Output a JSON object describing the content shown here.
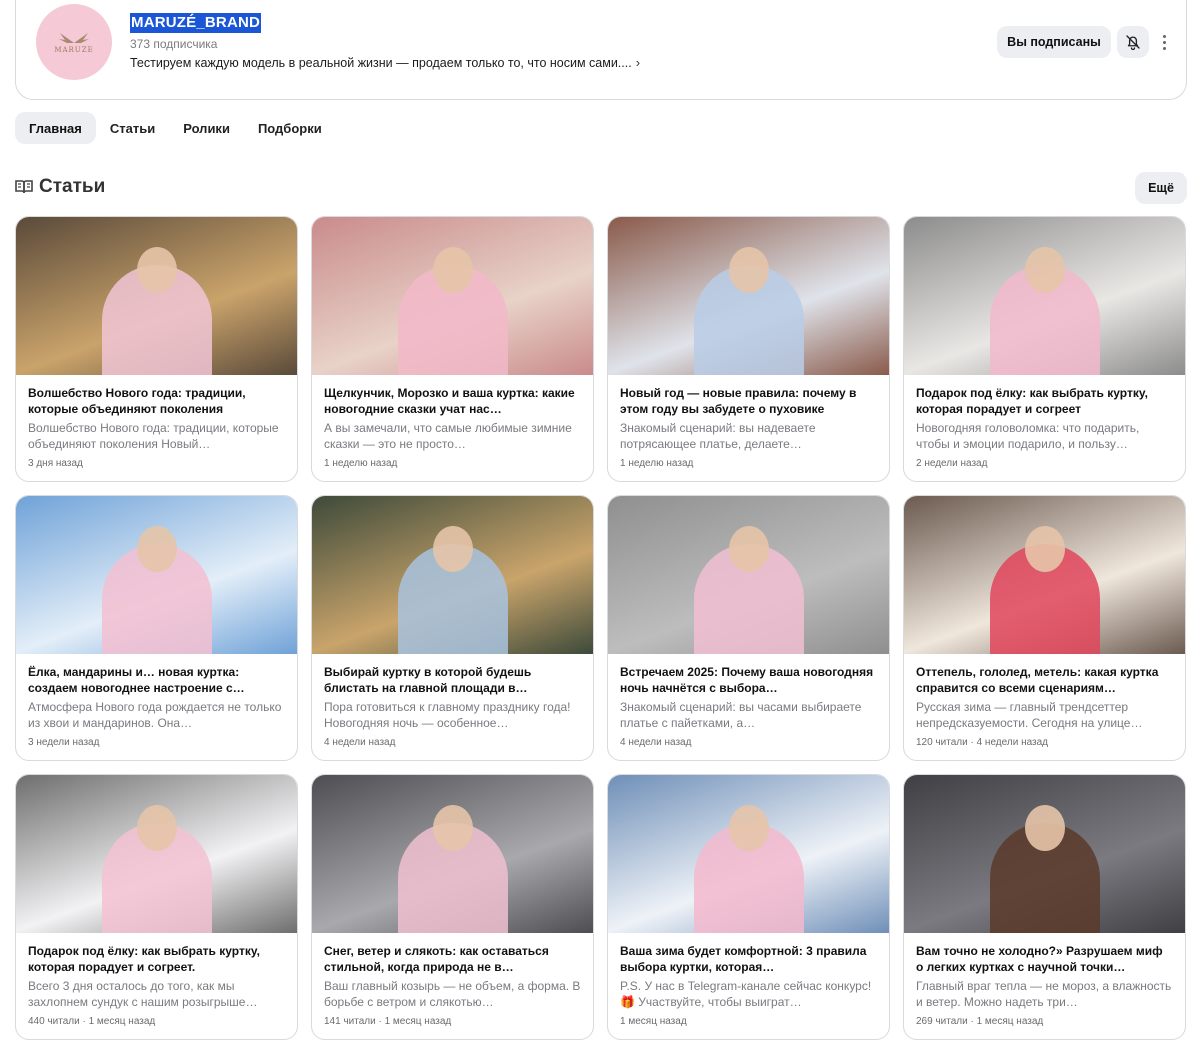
{
  "channel": {
    "logo_text": "MARUZE",
    "name": "MARUZÉ_BRAND",
    "subscribers": "373 подписчика",
    "description": "Тестируем каждую модель в реальной жизни — продаем только то, что носим сами....",
    "subscribed_label": "Вы подписаны"
  },
  "tabs": [
    {
      "label": "Главная",
      "active": true
    },
    {
      "label": "Статьи",
      "active": false
    },
    {
      "label": "Ролики",
      "active": false
    },
    {
      "label": "Подборки",
      "active": false
    }
  ],
  "section": {
    "title": "Статьи",
    "more_label": "Ещё"
  },
  "colors": {
    "accent_selection": "#1a56d6",
    "button_bg": "#eceef1",
    "avatar_bg": "#f6c9d6"
  },
  "articles": [
    {
      "title": "Волшебство Нового года: традиции, которые объединяют поколения",
      "snippet": "Волшебство Нового года: традиции, которые объединяют поколения Новый…",
      "meta": "3 дня назад",
      "palette": [
        "#5a4a3a",
        "#caa36b",
        "#f1c6d6"
      ]
    },
    {
      "title": "Щелкунчик, Морозко и ваша куртка: какие новогодние сказки учат нас…",
      "snippet": "А вы замечали, что самые любимые зимние сказки — это не просто…",
      "meta": "1 неделю назад",
      "palette": [
        "#c98b8b",
        "#e8d2c8",
        "#f2b9c9"
      ]
    },
    {
      "title": "Новый год — новые правила: почему в этом году вы забудете о пуховике",
      "snippet": "Знакомый сценарий: вы надеваете потрясающее платье, делаете…",
      "meta": "1 неделю назад",
      "palette": [
        "#8a5a4a",
        "#dfe3ea",
        "#b9cde6"
      ]
    },
    {
      "title": "Подарок под ёлку: как выбрать куртку, которая порадует и согреет",
      "snippet": "Новогодняя головоломка: что подарить, чтобы и эмоции подарило, и пользу…",
      "meta": "2 недели назад",
      "palette": [
        "#8c8c8c",
        "#e9e7e4",
        "#f2b8cc"
      ]
    },
    {
      "title": "Ёлка, мандарины и… новая куртка: создаем новогоднее настроение с…",
      "snippet": "Атмосфера Нового года рождается не только из хвои и мандаринов. Она…",
      "meta": "3 недели назад",
      "palette": [
        "#6fa2d8",
        "#e3eef8",
        "#f3bfd1"
      ]
    },
    {
      "title": "Выбирай куртку в которой будешь блистать на главной площади в…",
      "snippet": "Пора готовиться к главному празднику года! Новогодняя ночь — особенное…",
      "meta": "4 недели назад",
      "palette": [
        "#3d4a3a",
        "#c9a46b",
        "#a8c3df"
      ]
    },
    {
      "title": "Встречаем 2025: Почему ваша новогодняя ночь начнётся с выбора…",
      "snippet": "Знакомый сценарий: вы часами выбираете платье с пайетками, а…",
      "meta": "4 недели назад",
      "palette": [
        "#8f8f8f",
        "#bdbdbd",
        "#f1bfd2"
      ]
    },
    {
      "title": "Оттепель, гололед, метель: какая куртка справится со всеми сценариям…",
      "snippet": "Русская зима — главный трендсеттер непредсказуемости. Сегодня на улице…",
      "meta": "120 читали · 4 недели назад",
      "palette": [
        "#6b5a4f",
        "#efe6dc",
        "#e0455a"
      ]
    },
    {
      "title": "Подарок под ёлку: как выбрать куртку, которая порадует и согреет.",
      "snippet": "Всего 3 дня осталось до того, как мы захлопнем сундук с нашим розыгрыше…",
      "meta": "440 читали · 1 месяц назад",
      "palette": [
        "#6e6e6e",
        "#f2f2f4",
        "#f3c2d2"
      ]
    },
    {
      "title": "Снег, ветер и слякоть: как оставаться стильной, когда природа не в…",
      "snippet": "Ваш главный козырь — не объем, а форма. В борьбе с ветром и слякотью…",
      "meta": "141 читали · 1 месяц назад",
      "palette": [
        "#4d4d52",
        "#a9a9ad",
        "#f0c0cf"
      ]
    },
    {
      "title": "Ваша зима будет комфортной: 3 правила выбора куртки, которая…",
      "snippet": "P.S. У нас в Telegram-канале сейчас конкурс! 🎁 Участвуйте, чтобы выиграт…",
      "meta": "1 месяц назад",
      "palette": [
        "#6f8fb8",
        "#eef2f7",
        "#f3b9cc"
      ]
    },
    {
      "title": "Вам точно не холодно?» Разрушаем миф о легких куртках с научной точки…",
      "snippet": "Главный враг тепла — не мороз, а влажность и ветер. Можно надеть три…",
      "meta": "269 читали · 1 месяц назад",
      "palette": [
        "#3f3f44",
        "#7a7a80",
        "#5c3a2a"
      ]
    }
  ]
}
